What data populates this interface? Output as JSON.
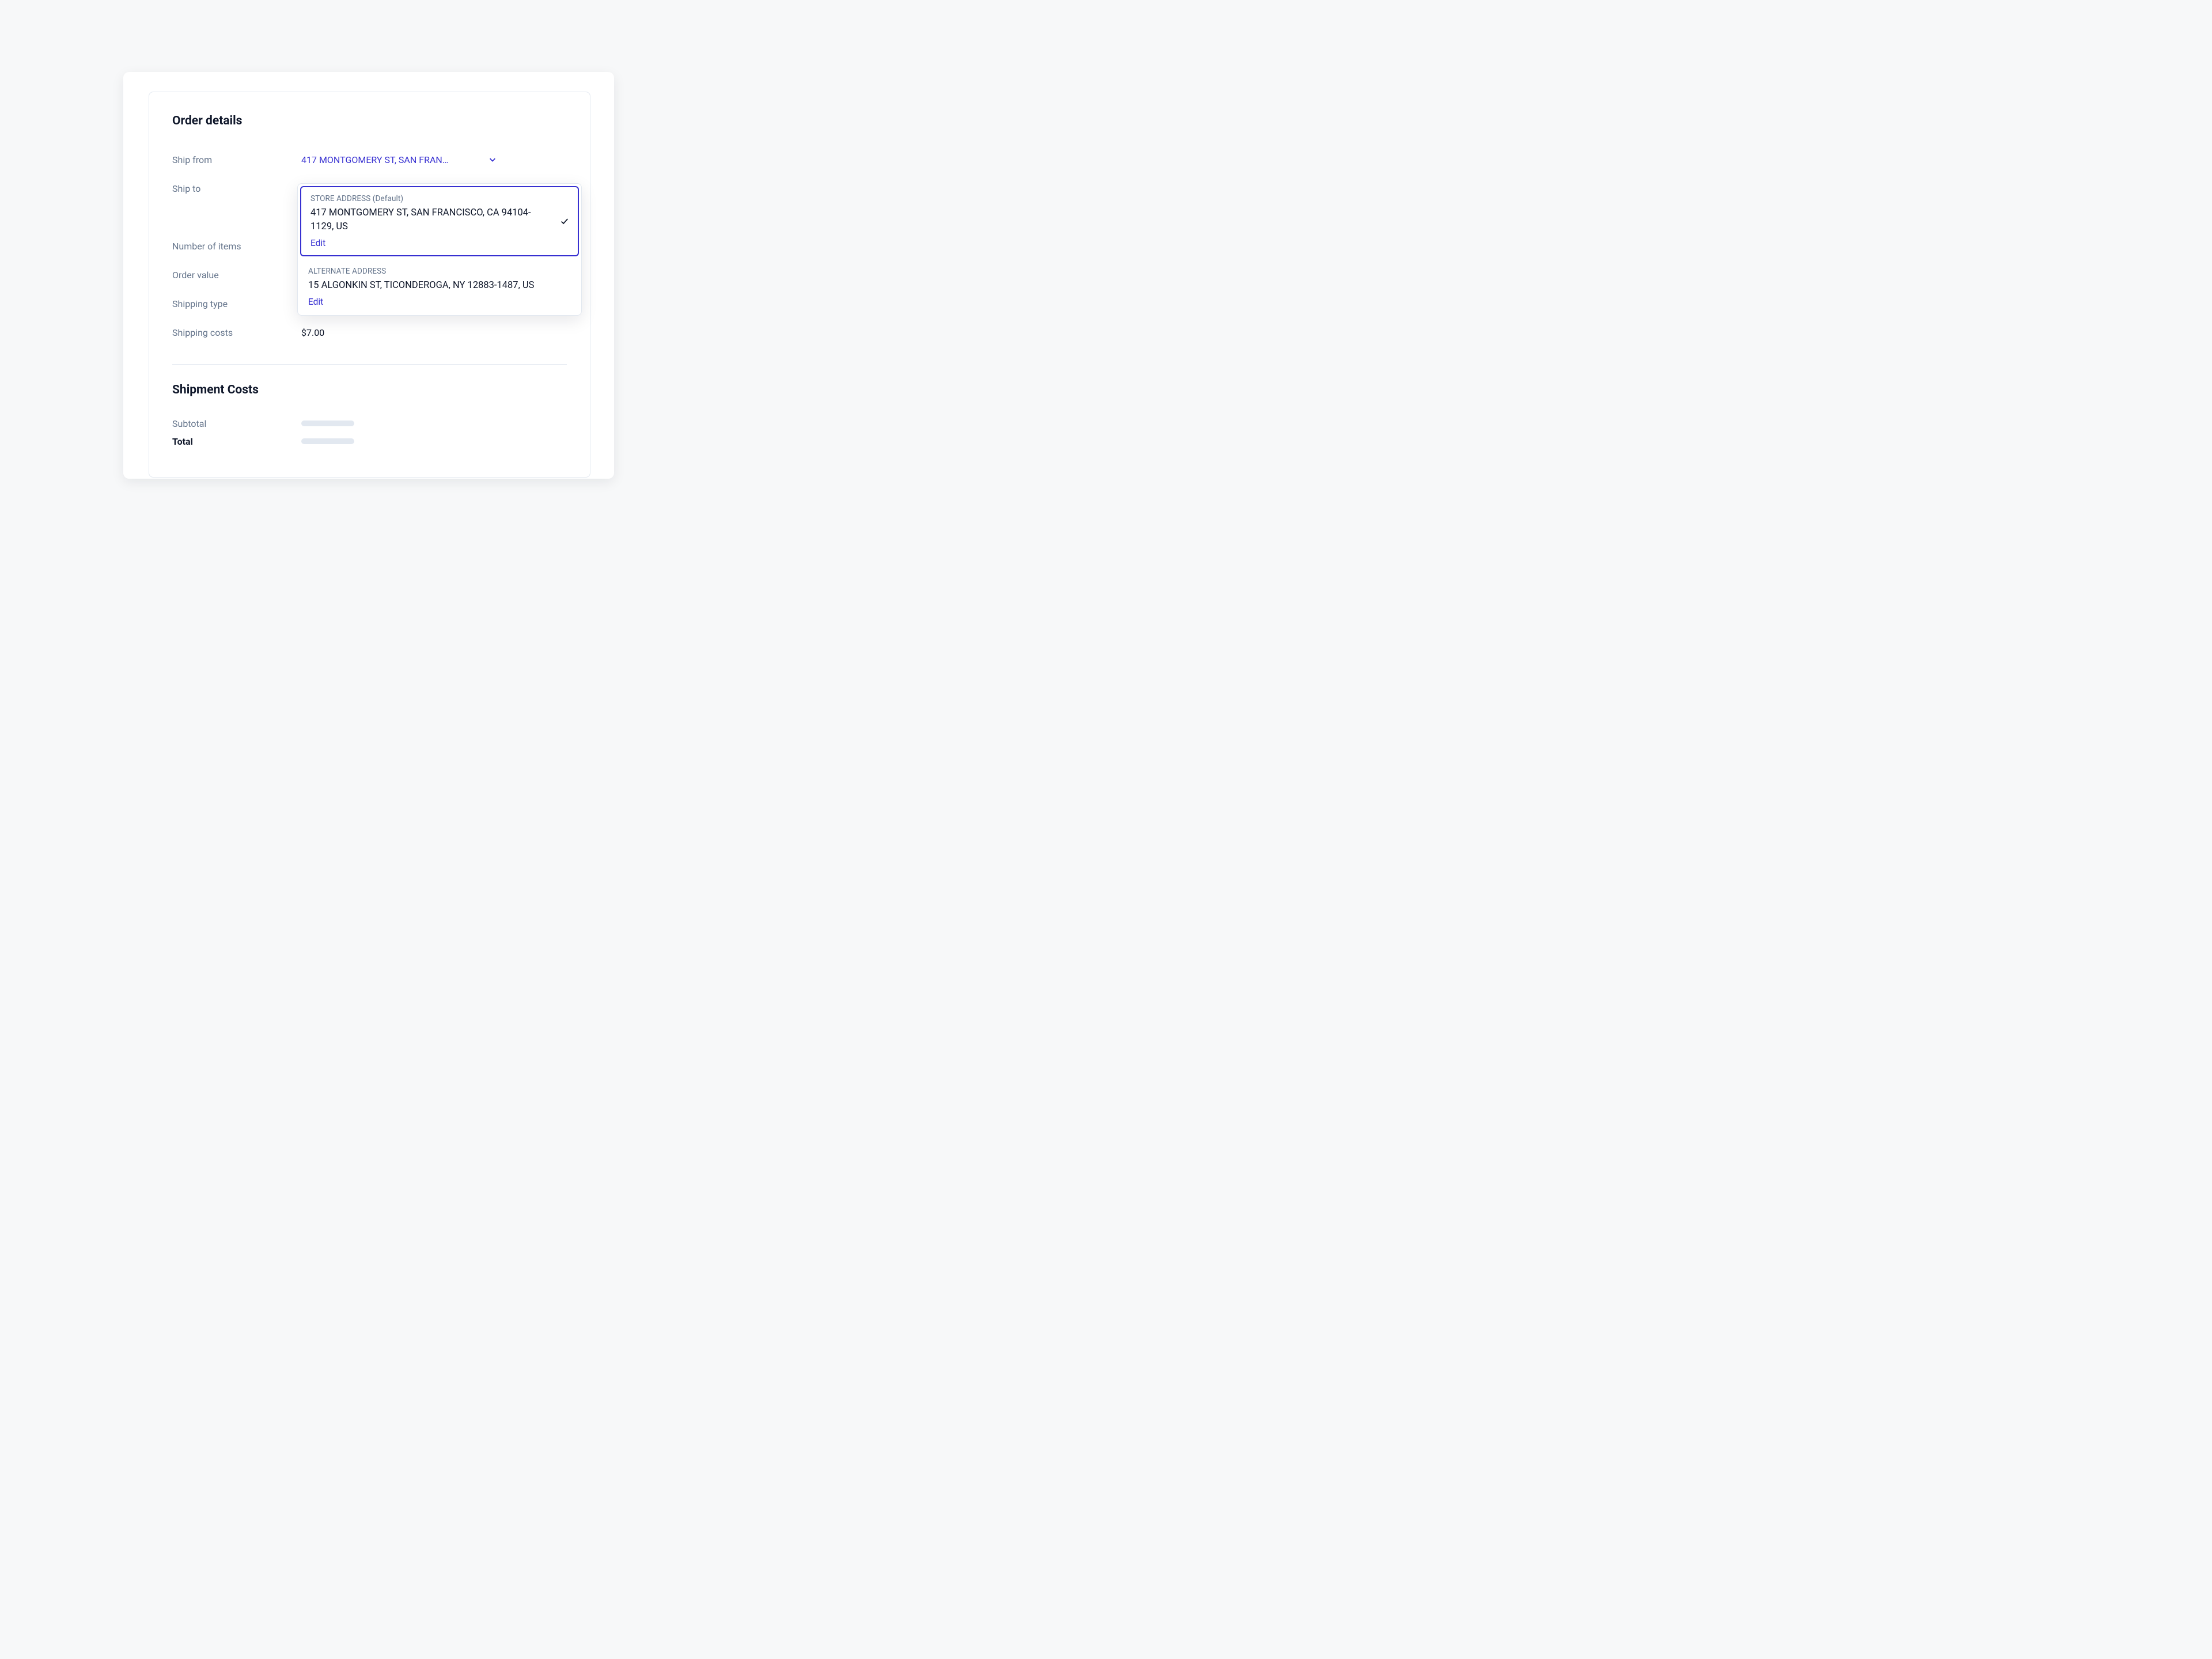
{
  "order_details": {
    "title": "Order details",
    "ship_from_label": "Ship from",
    "ship_from_selected": "417 MONTGOMERY ST, SAN FRAN…",
    "ship_to_label": "Ship to",
    "items_label": "Number of items",
    "value_label": "Order value",
    "type_label": "Shipping type",
    "costs_label": "Shipping costs",
    "shipping_cost_value": "$7.00"
  },
  "shipment_costs": {
    "title": "Shipment Costs",
    "subtotal_label": "Subtotal",
    "total_label": "Total"
  },
  "ship_to_dropdown": {
    "options": [
      {
        "title": "STORE ADDRESS (Default)",
        "address": "417 MONTGOMERY ST, SAN FRANCISCO, CA 94104-1129, US",
        "edit_label": "Edit",
        "selected": true
      },
      {
        "title": "ALTERNATE ADDRESS",
        "address": "15 ALGONKIN ST, TICONDEROGA, NY 12883-1487, US",
        "edit_label": "Edit",
        "selected": false
      }
    ]
  },
  "colors": {
    "accent": "#3730d1",
    "muted": "#64748b",
    "border": "#e2e8f0"
  }
}
